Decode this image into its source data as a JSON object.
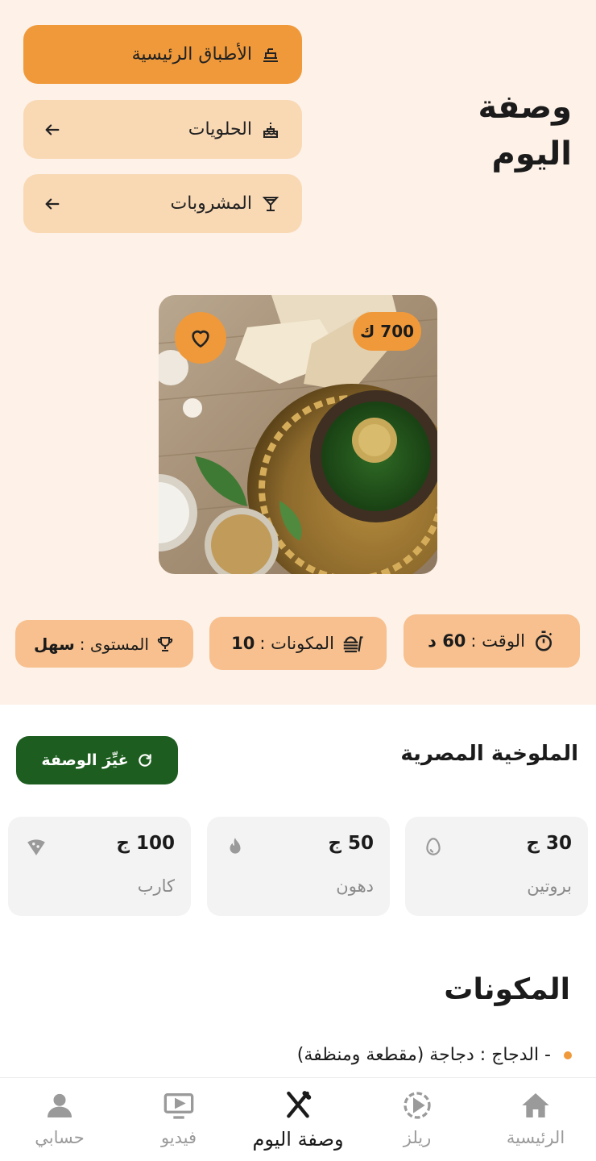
{
  "page": {
    "title": "وصفة اليوم"
  },
  "categories": [
    {
      "label": "الأطباق الرئيسية",
      "icon": "main-dish-icon",
      "active": true
    },
    {
      "label": "الحلويات",
      "icon": "cake-icon",
      "active": false
    },
    {
      "label": "المشروبات",
      "icon": "cocktail-glass-icon",
      "active": false
    }
  ],
  "recipe": {
    "calories_badge": "700 ك",
    "image": {
      "icon": "molokhia-dish-photo"
    },
    "stats": {
      "time": {
        "label": "الوقت :",
        "value": "60 د",
        "icon": "stopwatch-icon"
      },
      "ingredients": {
        "label": "المكونات :",
        "value": "10",
        "icon": "burger-icon"
      },
      "level": {
        "label": "المستوى :",
        "value": "سهل",
        "icon": "trophy-icon"
      }
    },
    "name": "الملوخية المصرية",
    "change_label": "غيِّرَ الوصفة",
    "macros": [
      {
        "value": "30 ج",
        "label": "بروتين",
        "icon": "egg-icon"
      },
      {
        "value": "50 ج",
        "label": "دهون",
        "icon": "flame-icon"
      },
      {
        "value": "100 ج",
        "label": "كارب",
        "icon": "pizza-icon"
      }
    ],
    "ingredients_title": "المكونات",
    "ingredients": [
      "- الدجاج : دجاجة (مقطعة ومنظفة)"
    ]
  },
  "colors": {
    "accent": "#f0993a",
    "chip": "#f7c08e",
    "green": "#1d5d1f",
    "hero_bg": "#fdf1e8"
  },
  "nav": [
    {
      "label": "الرئيسية",
      "icon": "home-icon",
      "active": false
    },
    {
      "label": "ريلز",
      "icon": "play-circle-icon",
      "active": false
    },
    {
      "label": "وصفة اليوم",
      "icon": "utensils-icon",
      "active": true
    },
    {
      "label": "فيديو",
      "icon": "tv-icon",
      "active": false
    },
    {
      "label": "حسابي",
      "icon": "user-icon",
      "active": false
    }
  ]
}
